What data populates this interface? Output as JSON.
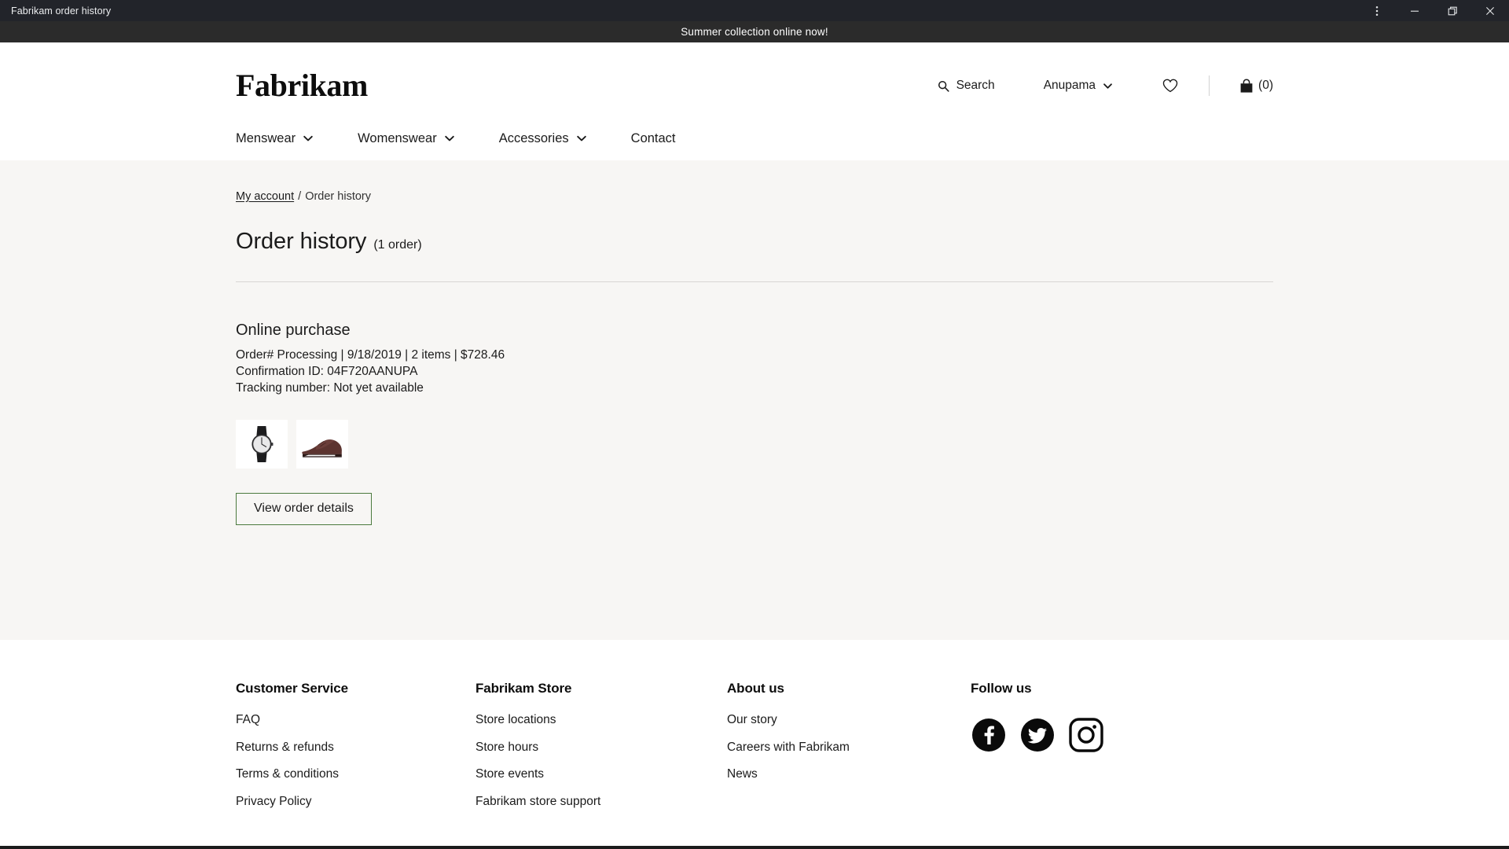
{
  "window": {
    "title": "Fabrikam order history",
    "controls": {
      "menu": "more-options",
      "minimize": "minimize",
      "maximize": "restore",
      "close": "close"
    }
  },
  "promo": {
    "message": "Summer collection online now!"
  },
  "header": {
    "brand": "Fabrikam",
    "actions": {
      "search_label": "Search",
      "account_label": "Anupama",
      "wishlist_label": "",
      "cart_count": "(0)"
    },
    "nav": [
      {
        "label": "Menswear",
        "has_chevron": true
      },
      {
        "label": "Womenswear",
        "has_chevron": true
      },
      {
        "label": "Accessories",
        "has_chevron": true
      },
      {
        "label": "Contact",
        "has_chevron": false
      }
    ]
  },
  "breadcrumb": {
    "parent": "My account",
    "separator": "/",
    "current": "Order history"
  },
  "page": {
    "title": "Order history",
    "count_label": "(1 order)"
  },
  "order": {
    "heading": "Online purchase",
    "meta": "Order# Processing | 9/18/2019 | 2 items | $728.46",
    "confirmation": "Confirmation ID: 04F720AANUPA",
    "tracking": "Tracking number: Not yet available",
    "thumbnails": [
      {
        "name": "wristwatch",
        "alt": "Black strap wristwatch"
      },
      {
        "name": "dress-shoe",
        "alt": "Brown leather dress shoe"
      }
    ],
    "details_button": "View order details"
  },
  "footer": {
    "columns": [
      {
        "heading": "Customer Service",
        "links": [
          "FAQ",
          "Returns & refunds",
          "Terms & conditions",
          "Privacy Policy"
        ]
      },
      {
        "heading": "Fabrikam Store",
        "links": [
          "Store locations",
          "Store hours",
          "Store events",
          "Fabrikam store support"
        ]
      },
      {
        "heading": "About us",
        "links": [
          "Our story",
          "Careers with Fabrikam",
          "News"
        ]
      }
    ],
    "follow": {
      "heading": "Follow us",
      "socials": [
        "facebook",
        "twitter",
        "instagram"
      ]
    }
  },
  "colors": {
    "titlebar_bg": "#22242a",
    "promo_bg": "#2b2b2b",
    "content_bg": "#f7f6f4",
    "button_border": "#4b7a3e",
    "text": "#1b1b1b",
    "divider": "#d8d6d3"
  }
}
